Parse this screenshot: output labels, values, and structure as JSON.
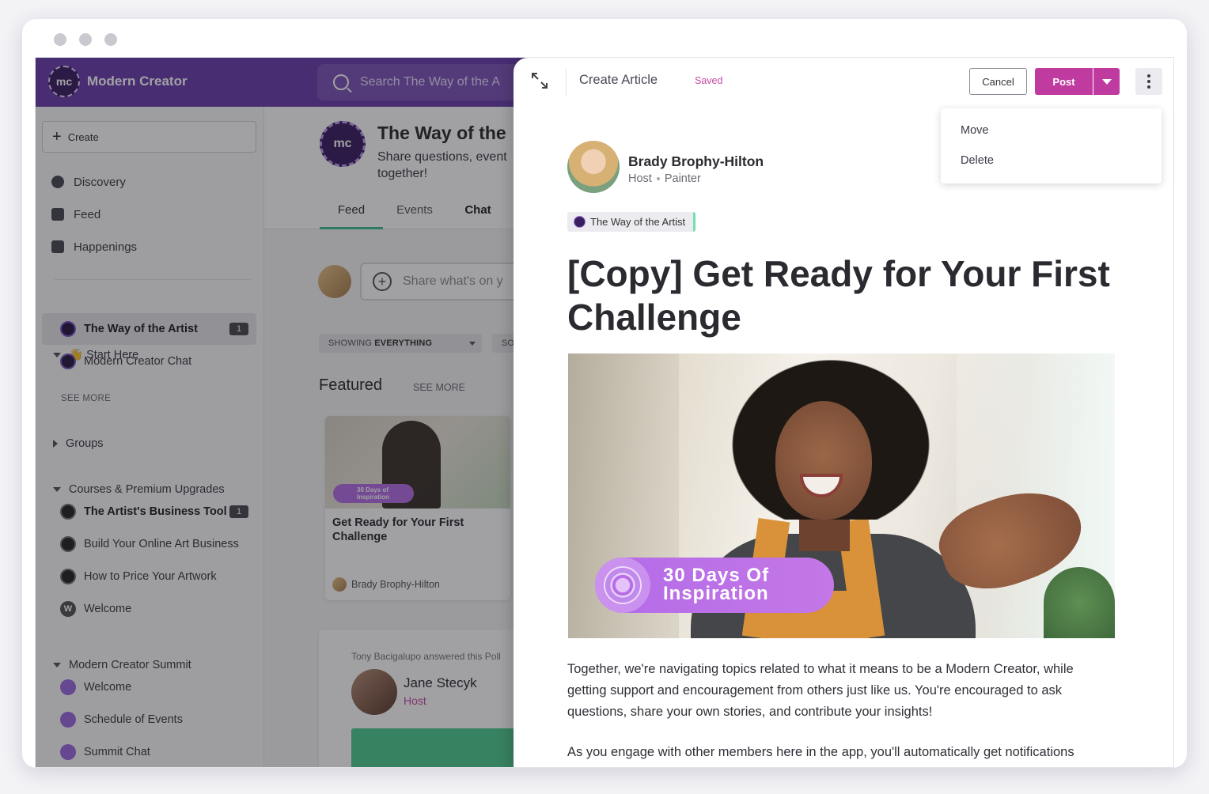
{
  "brand": {
    "name": "Modern Creator",
    "logo_text": "mc"
  },
  "search": {
    "placeholder": "Search The Way of the A"
  },
  "sidebar": {
    "create_label": "Create",
    "nav": [
      {
        "label": "Discovery",
        "icon": "compass-icon"
      },
      {
        "label": "Feed",
        "icon": "feed-icon"
      },
      {
        "label": "Happenings",
        "icon": "calendar-icon"
      }
    ],
    "sections": {
      "start_here": {
        "label": "👋 Start Here",
        "items": [
          {
            "label": "The Way of the Artist",
            "badge": "1"
          },
          {
            "label": "Modern Creator Chat"
          }
        ],
        "see_more": "SEE MORE"
      },
      "groups": {
        "label": "Groups"
      },
      "courses": {
        "label": "Courses & Premium Upgrades",
        "items": [
          {
            "label": "The Artist's Business Tool",
            "badge": "1"
          },
          {
            "label": "Build Your Online Art Business"
          },
          {
            "label": "How to Price Your Artwork"
          },
          {
            "label": "Welcome",
            "avatar": "W"
          }
        ]
      },
      "summit": {
        "label": "Modern Creator Summit",
        "items": [
          {
            "label": "Welcome"
          },
          {
            "label": "Schedule of Events"
          },
          {
            "label": "Summit Chat"
          }
        ]
      }
    }
  },
  "space": {
    "logo_text": "mc",
    "title": "The Way of the",
    "description": "Share questions, event together!",
    "tabs": [
      {
        "label": "Feed"
      },
      {
        "label": "Events"
      },
      {
        "label": "Chat"
      }
    ],
    "composer_placeholder": "Share what's on y",
    "filter_prefix": "SHOWING",
    "filter_value": "EVERYTHING",
    "filter2": "SO",
    "featured_title": "Featured",
    "featured_see_more": "SEE MORE",
    "card": {
      "pill_text": "30 Days of Inspiration",
      "title": "Get Ready for Your First Challenge",
      "author": "Brady Brophy-Hilton"
    },
    "poll": {
      "meta": "Tony Bacigalupo answered this Poll",
      "name": "Jane Stecyk",
      "role": "Host"
    }
  },
  "drawer": {
    "title": "Create Article",
    "status": "Saved",
    "cancel_label": "Cancel",
    "post_label": "Post",
    "menu": [
      {
        "label": "Move"
      },
      {
        "label": "Delete"
      }
    ],
    "author": {
      "name": "Brady Brophy-Hilton",
      "role": "Host",
      "subtitle": "Painter"
    },
    "space_tag": "The Way of the Artist",
    "article_title": "[Copy] Get Ready for Your First Challenge",
    "hero_badge": "30 Days Of Inspiration",
    "paragraphs": [
      "Together, we're navigating topics related to what it means to be a Modern Creator, while getting support and encouragement from others just like us. You're encouraged to ask questions, share your own stories, and contribute your insights!",
      "As you engage with other members here in the app, you'll automatically get notifications"
    ]
  },
  "colors": {
    "topbar": "#6b3fb0",
    "accent_pink": "#c03ba0",
    "tab_underline": "#3fbf8f"
  }
}
